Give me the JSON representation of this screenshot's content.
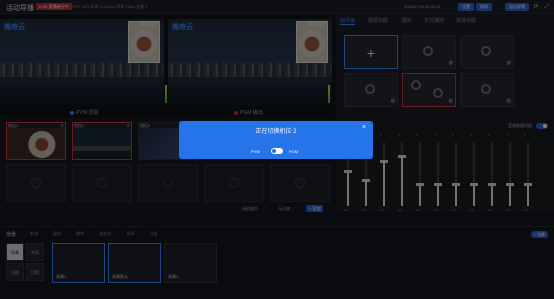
{
  "topbar": {
    "app_title": "活动导播",
    "live_tag": "LIVE 直播进行中",
    "stats": "CPU 36% 码率 2.0Mbps  帧率 25fps  丢帧 0",
    "clock": "2024/07/02  00:41:01",
    "buttons": [
      "设置",
      "帮助",
      "退出导播"
    ]
  },
  "monitors": {
    "logo": "美帝云",
    "time_overlay": "16:50",
    "pvw_label": "PVW 预监",
    "pgm_label": "PGM 播出"
  },
  "right_panel": {
    "tabs": [
      "画中画",
      "图层功能",
      "图片",
      "花式播控",
      "花体功能"
    ]
  },
  "sources": {
    "items": [
      {
        "label": "机位1"
      },
      {
        "label": "机位2"
      },
      {
        "label": "机位3"
      }
    ],
    "footer_left": "画面融合",
    "footer_mid": "无过渡",
    "footer_btn": "+ 添加"
  },
  "mixer": {
    "label": "音频跟随切换",
    "channels": [
      {
        "head": "♪",
        "val": "-12",
        "level": 0.55
      },
      {
        "head": "♪",
        "val": "-18",
        "level": 0.4
      },
      {
        "head": "♪",
        "val": "-20",
        "level": 0.7
      },
      {
        "head": "♪",
        "val": "-20",
        "level": 0.78
      },
      {
        "head": "♪",
        "val": "-12",
        "level": 0.35
      },
      {
        "head": "♪",
        "val": "-15",
        "level": 0.35
      },
      {
        "head": "♪",
        "val": "-15",
        "level": 0.35
      },
      {
        "head": "♪",
        "val": "-15",
        "level": 0.35
      },
      {
        "head": "♪",
        "val": "-15",
        "level": 0.35
      },
      {
        "head": "♪",
        "val": "-15",
        "level": 0.35
      },
      {
        "head": "♪",
        "val": "-15",
        "level": 0.35
      }
    ]
  },
  "bottom": {
    "title": "场景",
    "toolbar": "新增  复制  删除  重命名  排序  分组",
    "modes": [
      "场景",
      "布局",
      "导播",
      "切换"
    ],
    "scenes": [
      "场景1",
      "场景默认",
      "场景3"
    ],
    "tag": "+ 场景"
  },
  "modal": {
    "title": "正在切换机位 2",
    "pvw": "PVW",
    "pgm": "PGM"
  }
}
